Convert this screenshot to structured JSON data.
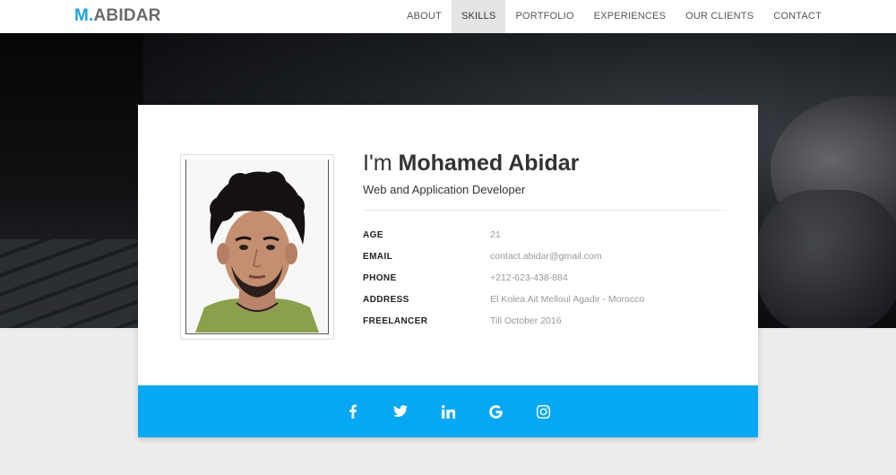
{
  "navbar": {
    "brand_accent": "M.",
    "brand_rest": "ABIDAR",
    "items": [
      {
        "label": "ABOUT",
        "active": false
      },
      {
        "label": "SKILLS",
        "active": true
      },
      {
        "label": "PORTFOLIO",
        "active": false
      },
      {
        "label": "EXPERIENCES",
        "active": false
      },
      {
        "label": "OUR CLIENTS",
        "active": false
      },
      {
        "label": "CONTACT",
        "active": false
      }
    ]
  },
  "profile": {
    "greeting": "I'm",
    "name": "Mohamed Abidar",
    "role": "Web and Application Developer",
    "details": [
      {
        "label": "AGE",
        "value": "21"
      },
      {
        "label": "EMAIL",
        "value": "contact.abidar@gmail.com"
      },
      {
        "label": "PHONE",
        "value": "+212-623-438-884"
      },
      {
        "label": "ADDRESS",
        "value": "El Kolea Ait Melloul Agadir - Morocco"
      },
      {
        "label": "FREELANCER",
        "value": "Till October 2016"
      }
    ]
  },
  "social": [
    {
      "icon": "facebook-icon"
    },
    {
      "icon": "twitter-icon"
    },
    {
      "icon": "linkedin-icon"
    },
    {
      "icon": "google-icon"
    },
    {
      "icon": "instagram-icon"
    }
  ],
  "colors": {
    "accent": "#1fa2e6",
    "social_bar": "#06a8f3",
    "nav_active_bg": "#e4e4e4",
    "page_bg": "#ececec"
  }
}
